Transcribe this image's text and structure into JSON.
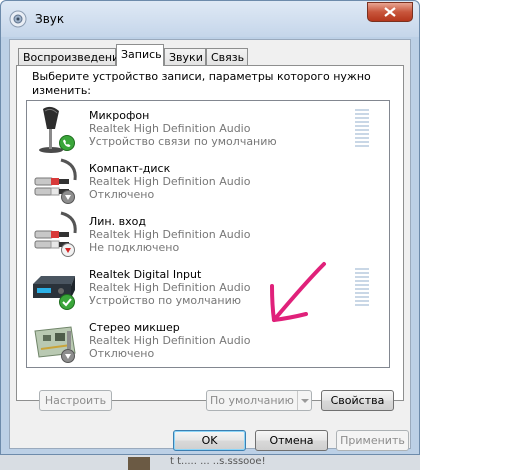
{
  "window": {
    "title": "Звук"
  },
  "tabs": [
    {
      "label": "Воспроизведение"
    },
    {
      "label": "Запись",
      "active": true
    },
    {
      "label": "Звуки"
    },
    {
      "label": "Связь"
    }
  ],
  "instruction": "Выберите устройство записи, параметры которого нужно изменить:",
  "devices": [
    {
      "name": "Микрофон",
      "driver": "Realtek High Definition Audio",
      "status": "Устройство связи по умолчанию",
      "icon": "microphone-icon",
      "badge": "phone-green-badge"
    },
    {
      "name": "Компакт-диск",
      "driver": "Realtek High Definition Audio",
      "status": "Отключено",
      "icon": "rca-cable-icon",
      "badge": "disabled-down-arrow-badge"
    },
    {
      "name": "Лин. вход",
      "driver": "Realtek High Definition Audio",
      "status": "Не подключено",
      "icon": "rca-cable-icon",
      "badge": "unplugged-red-arrow-badge"
    },
    {
      "name": "Realtek Digital Input",
      "driver": "Realtek High Definition Audio",
      "status": "Устройство по умолчанию",
      "icon": "digital-receiver-icon",
      "badge": "default-green-check-badge"
    },
    {
      "name": "Стерео микшер",
      "driver": "Realtek High Definition Audio",
      "status": "Отключено",
      "icon": "sound-card-icon",
      "badge": "disabled-down-arrow-badge"
    }
  ],
  "buttons": {
    "configure": "Настроить",
    "set_default": "По умолчанию",
    "properties": "Свойства",
    "ok": "OK",
    "cancel": "Отмена",
    "apply": "Применить"
  },
  "background_text": "t t..... ... ..s.sssooe!",
  "colors": {
    "annotation_arrow": "#e0217a",
    "accent_green": "#3aa63a"
  }
}
